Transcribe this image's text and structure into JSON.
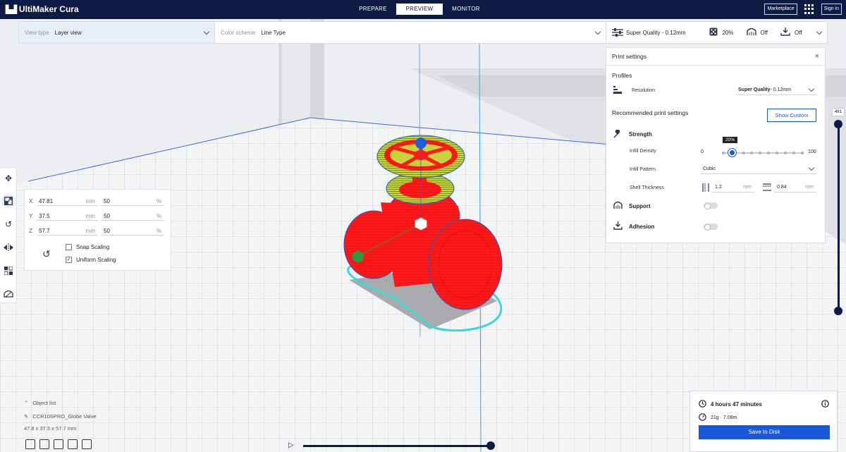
{
  "app": {
    "name": "UltiMaker Cura"
  },
  "header": {
    "tabs": [
      {
        "label": "PREPARE",
        "active": false
      },
      {
        "label": "PREVIEW",
        "active": true
      },
      {
        "label": "MONITOR",
        "active": false
      }
    ],
    "marketplace_label": "Marketplace",
    "signin_label": "Sign in"
  },
  "toolbar": {
    "view_type_label": "View type",
    "view_type_value": "Layer view",
    "color_scheme_label": "Color scheme",
    "color_scheme_value": "Line Type",
    "quality_summary": "Super Quality - 0.12mm",
    "infill_summary": "20%",
    "support_summary": "Off",
    "adhesion_summary": "Off"
  },
  "print_settings": {
    "title": "Print settings",
    "profiles_label": "Profiles",
    "resolution_label": "Resolution",
    "resolution_value_bold": "Super Quality",
    "resolution_value_rest": " - 0.12mm",
    "recommended_label": "Recommended print settings",
    "show_custom_label": "Show Custom",
    "strength_label": "Strength",
    "infill_density_label": "Infill Density",
    "infill_min": "0",
    "infill_max": "100",
    "infill_tooltip": "20%",
    "infill_value": 0.2,
    "infill_pattern_label": "Infill Pattern",
    "infill_pattern_value": "Cubic",
    "shell_thickness_label": "Shell Thickness",
    "wall_thickness_value": "1.2",
    "top_bottom_thickness_value": "0.84",
    "unit_mm": "mm",
    "support_label": "Support",
    "support_enabled": false,
    "adhesion_label": "Adhesion",
    "adhesion_enabled": false
  },
  "scale_panel": {
    "x_label": "X",
    "x_mm": "47.81",
    "x_pct": "50",
    "y_label": "Y",
    "y_mm": "37.5",
    "y_pct": "50",
    "z_label": "Z",
    "z_mm": "57.7",
    "z_pct": "50",
    "unit_mm": "mm",
    "unit_pct": "%",
    "snap_scaling_label": "Snap Scaling",
    "snap_scaling_checked": false,
    "uniform_scaling_label": "Uniform Scaling",
    "uniform_scaling_checked": true,
    "reset_icon": "reset-icon"
  },
  "left_tools": [
    "move-icon",
    "scale-icon",
    "rotate-icon",
    "mirror-icon",
    "per-model-settings-icon",
    "support-blocker-icon"
  ],
  "layer_slider": {
    "max_layer": "481"
  },
  "object_list": {
    "header": "Object list",
    "object_name": "CCR10SPRO_Globe Valve",
    "dimensions": "47.8 x 37.5 x 57.7 mm"
  },
  "estimate": {
    "time": "4 hours 47 minutes",
    "material": "21g · 7.08m",
    "save_label": "Save to Disk"
  },
  "colors": {
    "header_bg": "#0d1b44",
    "accent_blue": "#1a56d8",
    "model_red": "#ff1a1a",
    "travel_cyan": "#3fd6d6"
  }
}
